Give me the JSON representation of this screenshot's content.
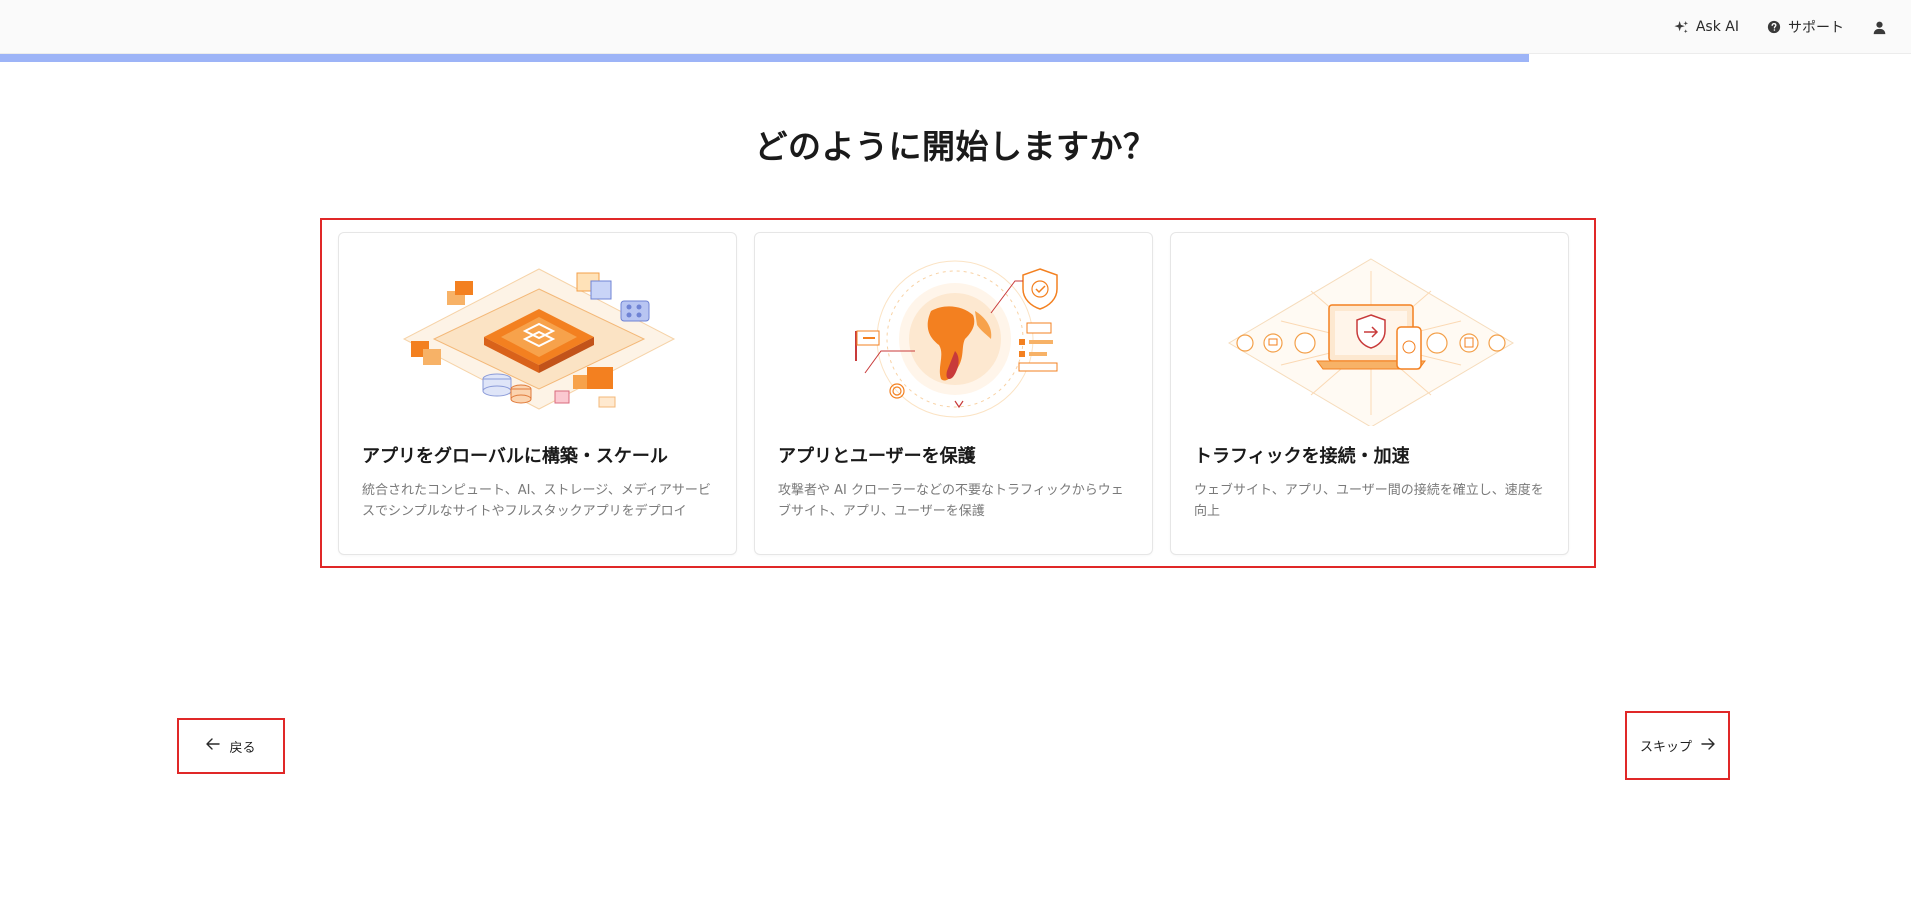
{
  "header": {
    "ask_ai_label": "Ask AI",
    "support_label": "サポート",
    "icons": {
      "ask_ai": "sparkle-icon",
      "support": "question-circle-icon",
      "account": "user-icon"
    }
  },
  "progress": {
    "percent": 80,
    "color": "#9db4f7"
  },
  "page": {
    "title": "どのように開始しますか？"
  },
  "options": [
    {
      "title": "アプリをグローバルに構築・スケール",
      "description": "統合されたコンピュート、AI、ストレージ、メディアサービスでシンプルなサイトやフルスタックアプリをデプロイ"
    },
    {
      "title": "アプリとユーザーを保護",
      "description": "攻撃者や AI クローラーなどの不要なトラフィックからウェブサイト、アプリ、ユーザーを保護"
    },
    {
      "title": "トラフィックを接続・加速",
      "description": "ウェブサイト、アプリ、ユーザー間の接続を確立し、速度を向上"
    }
  ],
  "nav": {
    "back_label": "戻る",
    "skip_label": "スキップ",
    "icons": {
      "back": "arrow-left-icon",
      "skip": "arrow-right-icon"
    }
  },
  "colors": {
    "accent_orange": "#f38020",
    "highlight_border": "#e02828"
  }
}
